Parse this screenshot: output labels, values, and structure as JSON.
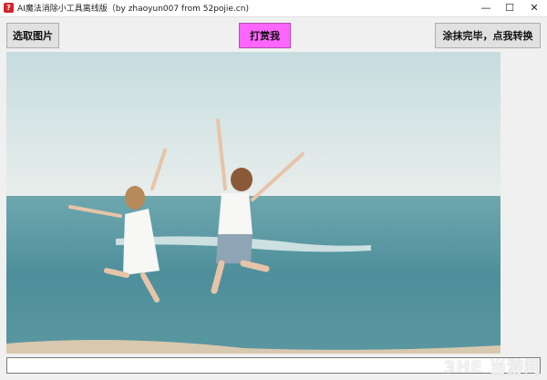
{
  "window": {
    "title": "AI魔法消除小工具离线版（by zhaoyun007 from 52pojie.cn)",
    "minimize_glyph": "—",
    "maximize_glyph": "☐",
    "close_glyph": "✕"
  },
  "toolbar": {
    "select_image_label": "选取图片",
    "reward_label": "打赏我",
    "convert_label": "涂抹完毕，点我转换"
  },
  "status_field": {
    "value": ""
  },
  "watermark": {
    "text": "3HE 当游网"
  },
  "colors": {
    "reward_button": "#ff66ff",
    "sky": "#c9dde0",
    "sea": "#5b9aa5",
    "sand": "#d9c8b0"
  }
}
